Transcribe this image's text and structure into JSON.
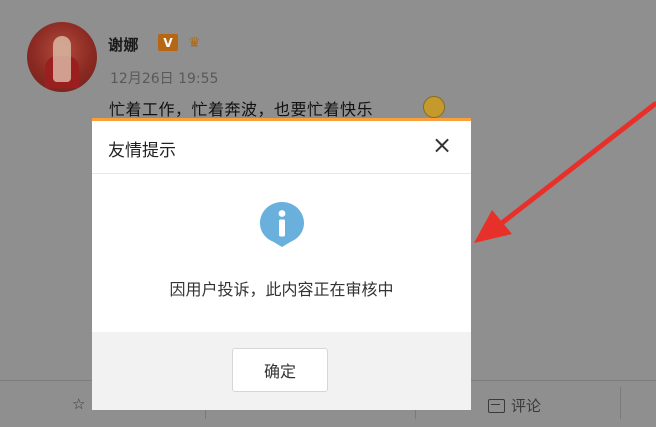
{
  "post": {
    "username": "谢娜",
    "v_badge": "V",
    "timestamp": "12月26日 19:55",
    "text": "忙着工作，忙着奔波，也要忙着快乐"
  },
  "actions": {
    "comment_label": "评论"
  },
  "dialog": {
    "title": "友情提示",
    "close_glyph": "×",
    "message": "因用户投诉，此内容正在审核中",
    "confirm_label": "确定",
    "accent_color": "#f7a03d",
    "icon_color": "#6ab0dc"
  },
  "annotation": {
    "arrow_color": "#e8302a"
  },
  "icons": [
    "avatar-image",
    "v-verified-icon",
    "crown-icon",
    "emoji-icon",
    "star-icon",
    "comment-icon",
    "close-icon",
    "info-icon",
    "red-arrow"
  ]
}
